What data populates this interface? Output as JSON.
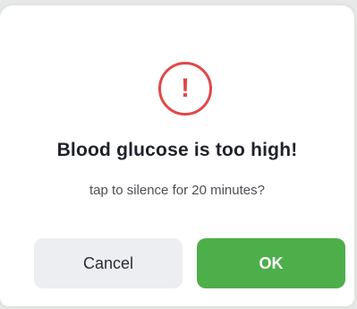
{
  "dialog": {
    "icon": "exclamation-icon",
    "icon_glyph": "!",
    "title": "Blood glucose is too high!",
    "message": "tap to silence for 20 minutes?",
    "cancel_label": "Cancel",
    "ok_label": "OK"
  },
  "colors": {
    "alert": "#e04848",
    "ok_button": "#4caf4a",
    "cancel_button": "#eceef1"
  }
}
